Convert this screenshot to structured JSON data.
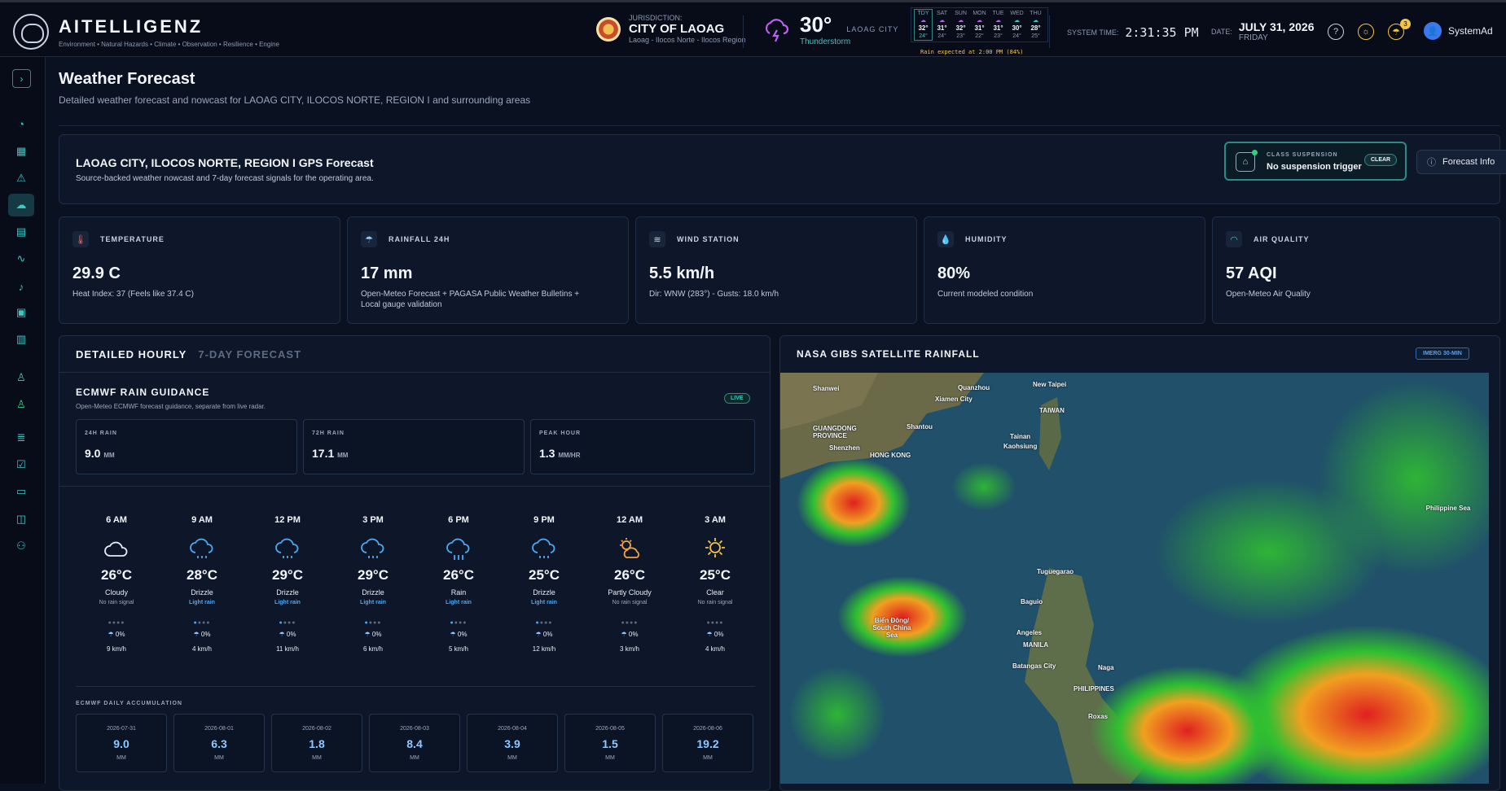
{
  "header": {
    "brand_name": "AITELLIGENZ",
    "brand_tagline": "Environment • Natural Hazards • Climate • Observation • Resilience • Engine",
    "jurisdiction_label": "JURISDICTION:",
    "jurisdiction_name": "CITY OF LAOAG",
    "jurisdiction_sub": "Laoag - Ilocos Norte - Ilocos Region",
    "current_temp": "30°",
    "current_city": "LAOAG CITY",
    "current_condition": "Thunderstorm",
    "week": [
      {
        "day": "TDY",
        "hi": "32°",
        "lo": "24°"
      },
      {
        "day": "SAT",
        "hi": "31°",
        "lo": "24°"
      },
      {
        "day": "SUN",
        "hi": "32°",
        "lo": "23°"
      },
      {
        "day": "MON",
        "hi": "31°",
        "lo": "22°"
      },
      {
        "day": "TUE",
        "hi": "31°",
        "lo": "23°"
      },
      {
        "day": "WED",
        "hi": "30°",
        "lo": "24°"
      },
      {
        "day": "THU",
        "hi": "28°",
        "lo": "25°"
      }
    ],
    "rain_expected": "Rain expected at 2:00 PM (84%)",
    "system_time_label": "SYSTEM TIME:",
    "system_time": "2:31:35 PM",
    "date_label": "DATE:",
    "date": "JULY 31, 2026",
    "weekday": "FRIDAY",
    "notification_count": "3",
    "username": "SystemAd"
  },
  "page": {
    "title": "Weather Forecast",
    "subtitle": "Detailed weather forecast and nowcast for LAOAG CITY, ILOCOS NORTE, REGION I and surrounding areas"
  },
  "gps": {
    "title": "LAOAG CITY, ILOCOS NORTE, REGION I GPS Forecast",
    "subtitle": "Source-backed weather nowcast and 7-day forecast signals for the operating area.",
    "class_suspension_label": "CLASS SUSPENSION",
    "class_suspension_value": "No suspension trigger",
    "class_suspension_status": "CLEAR",
    "forecast_info_label": "Forecast Info"
  },
  "metrics": [
    {
      "label": "TEMPERATURE",
      "value": "29.9 C",
      "sub": "Heat Index: 37 (Feels like 37.4 C)"
    },
    {
      "label": "RAINFALL 24H",
      "value": "17 mm",
      "sub": "Open-Meteo Forecast + PAGASA Public Weather Bulletins + Local gauge validation"
    },
    {
      "label": "WIND STATION",
      "value": "5.5 km/h",
      "sub": "Dir: WNW (283°) - Gusts: 18.0 km/h"
    },
    {
      "label": "HUMIDITY",
      "value": "80%",
      "sub": "Current modeled condition"
    },
    {
      "label": "AIR QUALITY",
      "value": "57 AQI",
      "sub": "Open-Meteo Air Quality"
    }
  ],
  "forecast": {
    "tab_active": "DETAILED HOURLY",
    "tab_inactive": "7-DAY FORECAST",
    "ecmwf_title": "ECMWF RAIN GUIDANCE",
    "ecmwf_sub": "Open-Meteo ECMWF forecast guidance, separate from live radar.",
    "live_label": "LIVE",
    "rain_boxes": [
      {
        "label": "24H RAIN",
        "value": "9.0",
        "unit": "MM"
      },
      {
        "label": "72H RAIN",
        "value": "17.1",
        "unit": "MM"
      },
      {
        "label": "PEAK HOUR",
        "value": "1.3",
        "unit": "MM/HR"
      }
    ],
    "hourly": [
      {
        "time": "6 AM",
        "icon": "cloud-icon",
        "temp": "26°C",
        "cond": "Cloudy",
        "signal": "No rain signal",
        "pct": "0%",
        "wind": "9 km/h"
      },
      {
        "time": "9 AM",
        "icon": "drizzle-icon",
        "temp": "28°C",
        "cond": "Drizzle",
        "signal": "Light rain",
        "pct": "0%",
        "wind": "4 km/h"
      },
      {
        "time": "12 PM",
        "icon": "drizzle-icon",
        "temp": "29°C",
        "cond": "Drizzle",
        "signal": "Light rain",
        "pct": "0%",
        "wind": "11 km/h"
      },
      {
        "time": "3 PM",
        "icon": "drizzle-icon",
        "temp": "29°C",
        "cond": "Drizzle",
        "signal": "Light rain",
        "pct": "0%",
        "wind": "6 km/h"
      },
      {
        "time": "6 PM",
        "icon": "rain-icon",
        "temp": "26°C",
        "cond": "Rain",
        "signal": "Light rain",
        "pct": "0%",
        "wind": "5 km/h"
      },
      {
        "time": "9 PM",
        "icon": "drizzle-icon",
        "temp": "25°C",
        "cond": "Drizzle",
        "signal": "Light rain",
        "pct": "0%",
        "wind": "12 km/h"
      },
      {
        "time": "12 AM",
        "icon": "partly-cloudy-icon",
        "temp": "26°C",
        "cond": "Partly Cloudy",
        "signal": "No rain signal",
        "pct": "0%",
        "wind": "3 km/h"
      },
      {
        "time": "3 AM",
        "icon": "sun-icon",
        "temp": "25°C",
        "cond": "Clear",
        "signal": "No rain signal",
        "pct": "0%",
        "wind": "4 km/h"
      }
    ],
    "accum_title": "ECMWF DAILY ACCUMULATION",
    "daily_accum": [
      {
        "date": "2026-07-31",
        "value": "9.0",
        "unit": "MM"
      },
      {
        "date": "2026-08-01",
        "value": "6.3",
        "unit": "MM"
      },
      {
        "date": "2026-08-02",
        "value": "1.8",
        "unit": "MM"
      },
      {
        "date": "2026-08-03",
        "value": "8.4",
        "unit": "MM"
      },
      {
        "date": "2026-08-04",
        "value": "3.9",
        "unit": "MM"
      },
      {
        "date": "2026-08-05",
        "value": "1.5",
        "unit": "MM"
      },
      {
        "date": "2026-08-06",
        "value": "19.2",
        "unit": "MM"
      }
    ]
  },
  "satellite": {
    "title": "NASA GIBS SATELLITE RAINFALL",
    "badge": "IMERG 30-MIN",
    "map_labels": {
      "shanwei": "Shanwei",
      "quanzhou": "Quanzhou",
      "xiamen": "Xiamen City",
      "new_taipei": "New Taipei",
      "taiwan": "TAIWAN",
      "guangdong": "GUANGDONG PROVINCE",
      "shantou": "Shantou",
      "shenzhen": "Shenzhen",
      "hong_kong": "HONG KONG",
      "tainan": "Tainan",
      "kaohsiung": "Kaohsiung",
      "philippine_sea": "Philippine Sea",
      "tuguegarao": "Tuguegarao",
      "baguio": "Baguio",
      "south_china_sea": "Biển Đông/ South China Sea",
      "angeles": "Angeles",
      "manila": "MANILA",
      "naga": "Naga",
      "batangas": "Batangas City",
      "philippines": "PHILIPPINES",
      "roxas": "Roxas"
    }
  },
  "colors": {
    "accent": "#3ec7c0",
    "background": "#0a1120",
    "card": "#0e1729",
    "rain_text": "#8fc8ff",
    "warning": "#f4c543"
  }
}
